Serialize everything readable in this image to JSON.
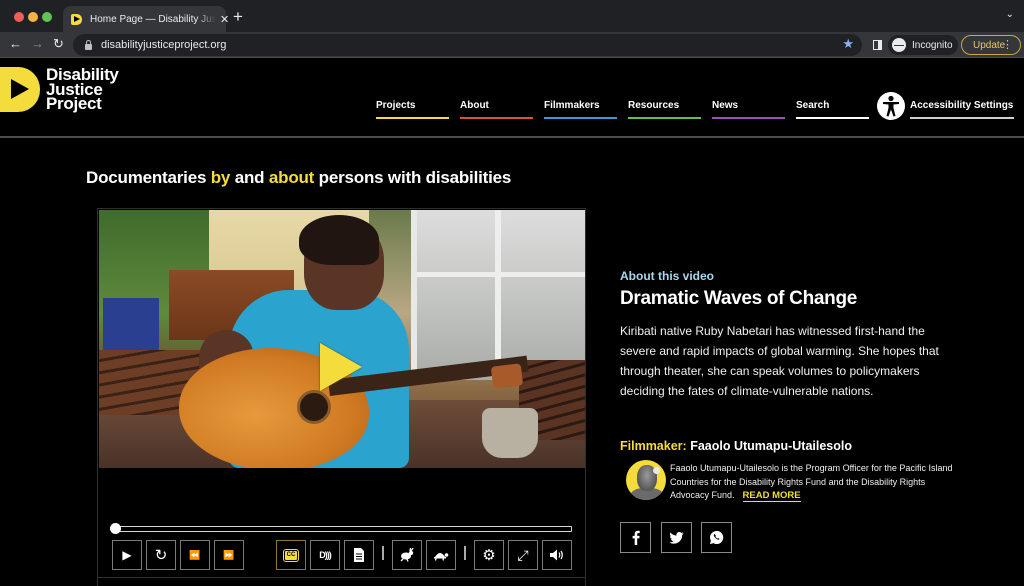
{
  "browser": {
    "tab_title": "Home Page — Disability Justice Project",
    "url": "disabilityjusticeproject.org",
    "incognito_label": "Incognito",
    "update_label": "Update",
    "icons": {
      "back": "←",
      "forward": "→",
      "reload": "↻",
      "new_tab": "+",
      "close": "✕",
      "tab_list": "⌄",
      "star": "★",
      "kebab": "⋮"
    }
  },
  "site": {
    "logo_lines": [
      "Disability",
      "Justice",
      "Project"
    ],
    "nav": [
      {
        "label": "Projects",
        "color": "#f4dc3d"
      },
      {
        "label": "About",
        "color": "#d9532c"
      },
      {
        "label": "Filmmakers",
        "color": "#3a9ad9"
      },
      {
        "label": "Resources",
        "color": "#6cbf3c"
      },
      {
        "label": "News",
        "color": "#9a4fc2"
      },
      {
        "label": "Search",
        "color": "#ffffff"
      }
    ],
    "accessibility_label": "Accessibility Settings",
    "tagline": {
      "part1": "Documentaries ",
      "hl1": "by",
      "part2": " and ",
      "hl2": "about",
      "part3": " persons with disabilities"
    }
  },
  "player": {
    "progress": 0,
    "controls": [
      {
        "name": "play-button",
        "icon": "▶"
      },
      {
        "name": "restart-button",
        "icon": "↻"
      },
      {
        "name": "rewind-button",
        "icon": "⏪"
      },
      {
        "name": "fast-forward-button",
        "icon": "⏩"
      },
      {
        "name": "captions-button",
        "icon": "CC",
        "active": true
      },
      {
        "name": "audio-description-button",
        "icon": "D)))"
      },
      {
        "name": "transcript-button",
        "icon": "📄"
      },
      {
        "name": "faster-button",
        "icon": "🐇"
      },
      {
        "name": "slower-button",
        "icon": "🐢"
      },
      {
        "name": "settings-button",
        "icon": "⚙"
      },
      {
        "name": "fullscreen-button",
        "icon": "⤢"
      },
      {
        "name": "volume-button",
        "icon": "🔊"
      }
    ]
  },
  "video_info": {
    "section_label": "About this video",
    "title": "Dramatic Waves of Change",
    "description": "Kiribati native Ruby Nabetari has witnessed first-hand the severe and rapid impacts of global warming. She hopes that through theater, she can speak volumes to policymakers deciding the fates of climate-vulnerable nations.",
    "filmmaker_label": "Filmmaker:",
    "filmmaker_name": "Faaolo Utumapu-Utailesolo",
    "bio": "Faaolo Utumapu-Utailesolo is the Program Officer for the Pacific Island Countries for the Disability Rights Fund and the Disability Rights Advocacy Fund.",
    "read_more": "READ MORE",
    "share": {
      "facebook": "f",
      "twitter": "🐦",
      "whatsapp": "✆"
    }
  },
  "colors": {
    "accent_yellow": "#f4dc3d",
    "about_label": "#a8d8ec",
    "background": "#000000"
  }
}
